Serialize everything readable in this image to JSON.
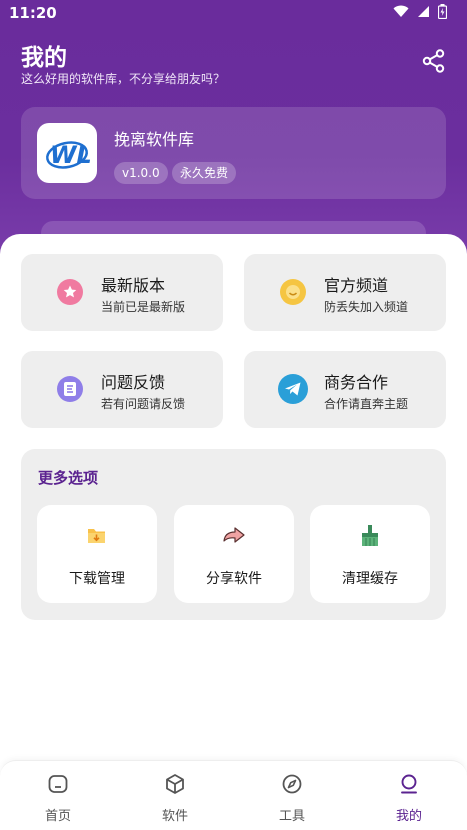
{
  "status_bar": {
    "time": "11:20"
  },
  "header": {
    "title": "我的",
    "subtitle": "这么好用的软件库，不分享给朋友吗？"
  },
  "app_card": {
    "logo_text": "WL",
    "name": "挽离软件库",
    "version": "v1.0.0",
    "license": "永久免费"
  },
  "features": [
    {
      "title": "最新版本",
      "desc": "当前已是最新版",
      "icon": "star-icon",
      "color": "#f07aa0"
    },
    {
      "title": "官方频道",
      "desc": "防丢失加入频道",
      "icon": "smile-icon",
      "color": "#f5c542"
    },
    {
      "title": "问题反馈",
      "desc": "若有问题请反馈",
      "icon": "feedback-icon",
      "color": "#8f7ee8"
    },
    {
      "title": "商务合作",
      "desc": "合作请直奔主题",
      "icon": "telegram-icon",
      "color": "#2a9fd8"
    }
  ],
  "more": {
    "title": "更多选项",
    "options": [
      {
        "label": "下载管理",
        "icon": "download-folder-icon"
      },
      {
        "label": "分享软件",
        "icon": "share-arrow-icon"
      },
      {
        "label": "清理缓存",
        "icon": "broom-icon"
      }
    ]
  },
  "nav": [
    {
      "label": "首页",
      "icon": "home-icon",
      "active": false
    },
    {
      "label": "软件",
      "icon": "cube-icon",
      "active": false
    },
    {
      "label": "工具",
      "icon": "compass-icon",
      "active": false
    },
    {
      "label": "我的",
      "icon": "profile-icon",
      "active": true
    }
  ],
  "colors": {
    "brand": "#6a2c9c",
    "accent_text": "#5b2390"
  }
}
